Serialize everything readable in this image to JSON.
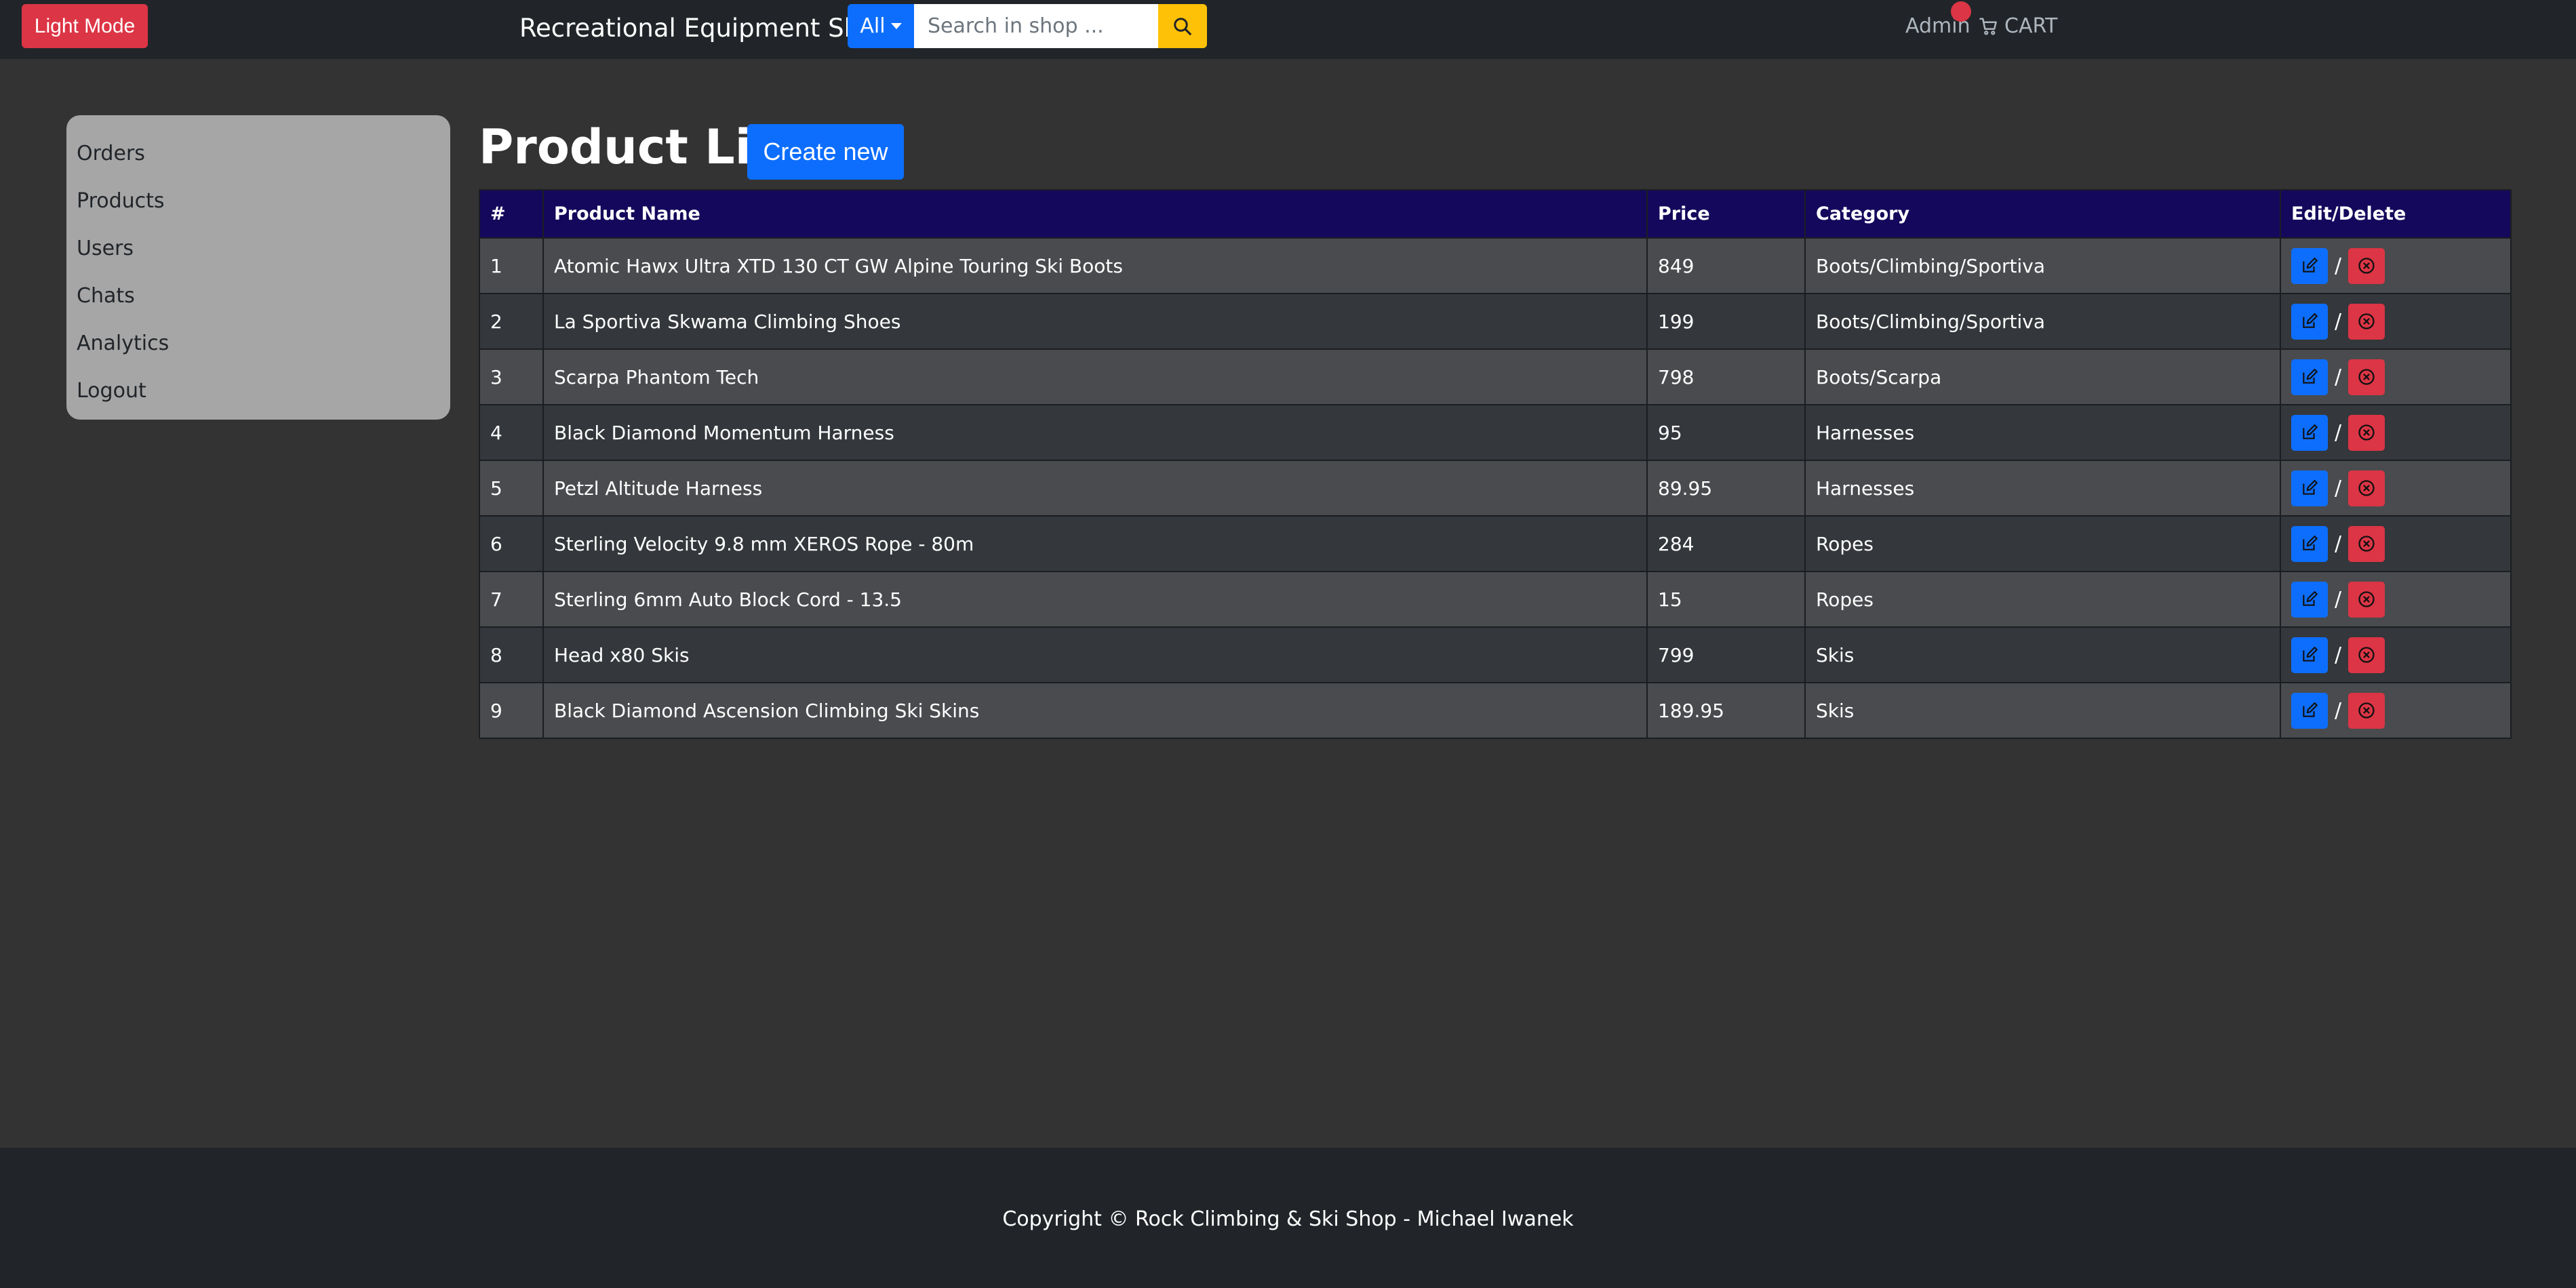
{
  "navbar": {
    "mode_button": "Light Mode",
    "brand": "Recreational Equipment Shop",
    "search": {
      "category": "All",
      "placeholder": "Search in shop ..."
    },
    "admin": "Admin",
    "cart": "CART",
    "colors": {
      "mode_button": "#dc3545",
      "search_button": "#ffc107",
      "category": "#0d6efd"
    }
  },
  "sidebar": {
    "items": [
      {
        "label": "Orders"
      },
      {
        "label": "Products"
      },
      {
        "label": "Users"
      },
      {
        "label": "Chats"
      },
      {
        "label": "Analytics"
      },
      {
        "label": "Logout"
      }
    ]
  },
  "main": {
    "title": "Product List",
    "create_button": "Create new",
    "table": {
      "headers": [
        "#",
        "Product Name",
        "Price",
        "Category",
        "Edit/Delete"
      ],
      "separator": "/",
      "rows": [
        {
          "num": "1",
          "name": "Atomic Hawx Ultra XTD 130 CT GW Alpine Touring Ski Boots",
          "price": "849",
          "category": "Boots/Climbing/Sportiva"
        },
        {
          "num": "2",
          "name": "La Sportiva Skwama Climbing Shoes",
          "price": "199",
          "category": "Boots/Climbing/Sportiva"
        },
        {
          "num": "3",
          "name": "Scarpa Phantom Tech",
          "price": "798",
          "category": "Boots/Scarpa"
        },
        {
          "num": "4",
          "name": "Black Diamond Momentum Harness",
          "price": "95",
          "category": "Harnesses"
        },
        {
          "num": "5",
          "name": "Petzl Altitude Harness",
          "price": "89.95",
          "category": "Harnesses"
        },
        {
          "num": "6",
          "name": "Sterling Velocity 9.8 mm XEROS Rope - 80m",
          "price": "284",
          "category": "Ropes"
        },
        {
          "num": "7",
          "name": "Sterling 6mm Auto Block Cord - 13.5",
          "price": "15",
          "category": "Ropes"
        },
        {
          "num": "8",
          "name": "Head x80 Skis",
          "price": "799",
          "category": "Skis"
        },
        {
          "num": "9",
          "name": "Black Diamond Ascension Climbing Ski Skins",
          "price": "189.95",
          "category": "Skis"
        }
      ]
    }
  },
  "footer": {
    "copyright": "Copyright © Rock Climbing & Ski Shop - Michael Iwanek"
  }
}
